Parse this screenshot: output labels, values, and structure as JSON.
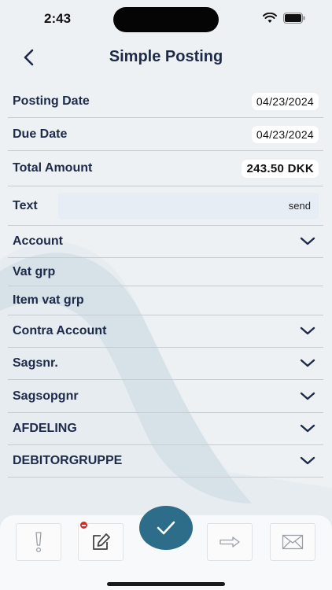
{
  "status": {
    "time": "2:43"
  },
  "header": {
    "title": "Simple Posting"
  },
  "form": {
    "posting_date": {
      "label": "Posting Date",
      "value": "04/23/2024"
    },
    "due_date": {
      "label": "Due Date",
      "value": "04/23/2024"
    },
    "total_amount": {
      "label": "Total Amount",
      "value": "243.50 DKK"
    },
    "text": {
      "label": "Text",
      "send_label": "send"
    },
    "account": {
      "label": "Account"
    },
    "vat_grp": {
      "label": "Vat grp"
    },
    "item_vat_grp": {
      "label": "Item vat grp"
    },
    "contra_account": {
      "label": "Contra Account"
    },
    "sagsnr": {
      "label": "Sagsnr."
    },
    "sagsopgnr": {
      "label": "Sagsopgnr"
    },
    "afdeling": {
      "label": "AFDELING"
    },
    "debitorgruppe": {
      "label": "DEBITORGRUPPE"
    }
  },
  "toolbar": {
    "icons": [
      "exclamation-icon",
      "edit-icon",
      "check-icon",
      "arrow-right-icon",
      "envelope-icon"
    ]
  },
  "colors": {
    "accent": "#2e6d8a",
    "text": "#1d2a4a",
    "badge": "#e02424"
  }
}
